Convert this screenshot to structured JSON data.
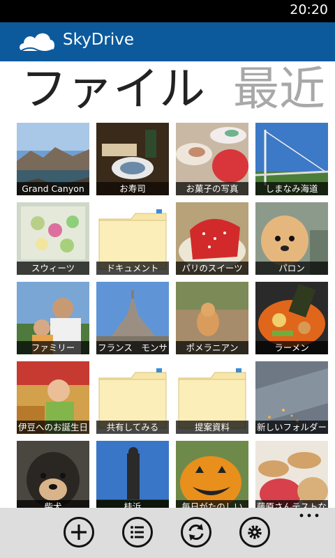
{
  "status": {
    "time": "20:20"
  },
  "app": {
    "title": "SkyDrive"
  },
  "pivot": {
    "active": "ファイル",
    "next": "最近"
  },
  "tiles": [
    {
      "label": "Grand Canyon",
      "kind": "photo",
      "thumb": "landscape"
    },
    {
      "label": "お寿司",
      "kind": "photo",
      "thumb": "sushi"
    },
    {
      "label": "お菓子の写真",
      "kind": "photo",
      "thumb": "sweets"
    },
    {
      "label": "しまなみ海道",
      "kind": "photo",
      "thumb": "bridge"
    },
    {
      "label": "スウィーツ",
      "kind": "photo",
      "thumb": "box"
    },
    {
      "label": "ドキュメント",
      "kind": "folder"
    },
    {
      "label": "パリのスイーツ",
      "kind": "photo",
      "thumb": "cake"
    },
    {
      "label": "パロン",
      "kind": "photo",
      "thumb": "dog"
    },
    {
      "label": "ファミリー",
      "kind": "photo",
      "thumb": "family"
    },
    {
      "label": "フランス　モンサ",
      "kind": "photo",
      "thumb": "castle"
    },
    {
      "label": "ポメラニアン",
      "kind": "photo",
      "thumb": "dog2"
    },
    {
      "label": "ラーメン",
      "kind": "photo",
      "thumb": "ramen"
    },
    {
      "label": "伊豆へのお誕生日",
      "kind": "photo",
      "thumb": "baby"
    },
    {
      "label": "共有してみる",
      "kind": "folder"
    },
    {
      "label": "提案資料",
      "kind": "folder"
    },
    {
      "label": "新しいフォルダー",
      "kind": "photo",
      "thumb": "glitter"
    },
    {
      "label": "柴犬",
      "kind": "photo",
      "thumb": "shiba"
    },
    {
      "label": "桂浜",
      "kind": "photo",
      "thumb": "statue"
    },
    {
      "label": "毎日がたのしい",
      "kind": "photo",
      "thumb": "pumpkin"
    },
    {
      "label": "藤原さんテストな",
      "kind": "photo",
      "thumb": "macaron"
    }
  ],
  "appbar": {
    "buttons": [
      {
        "icon": "add-icon"
      },
      {
        "icon": "list-icon"
      },
      {
        "icon": "sync-icon"
      },
      {
        "icon": "settings-icon"
      }
    ],
    "more_icon": "ellipsis-icon"
  },
  "colors": {
    "accent": "#0c5a9c",
    "appbar": "#dddddd",
    "folder": "#f7e6a8"
  }
}
